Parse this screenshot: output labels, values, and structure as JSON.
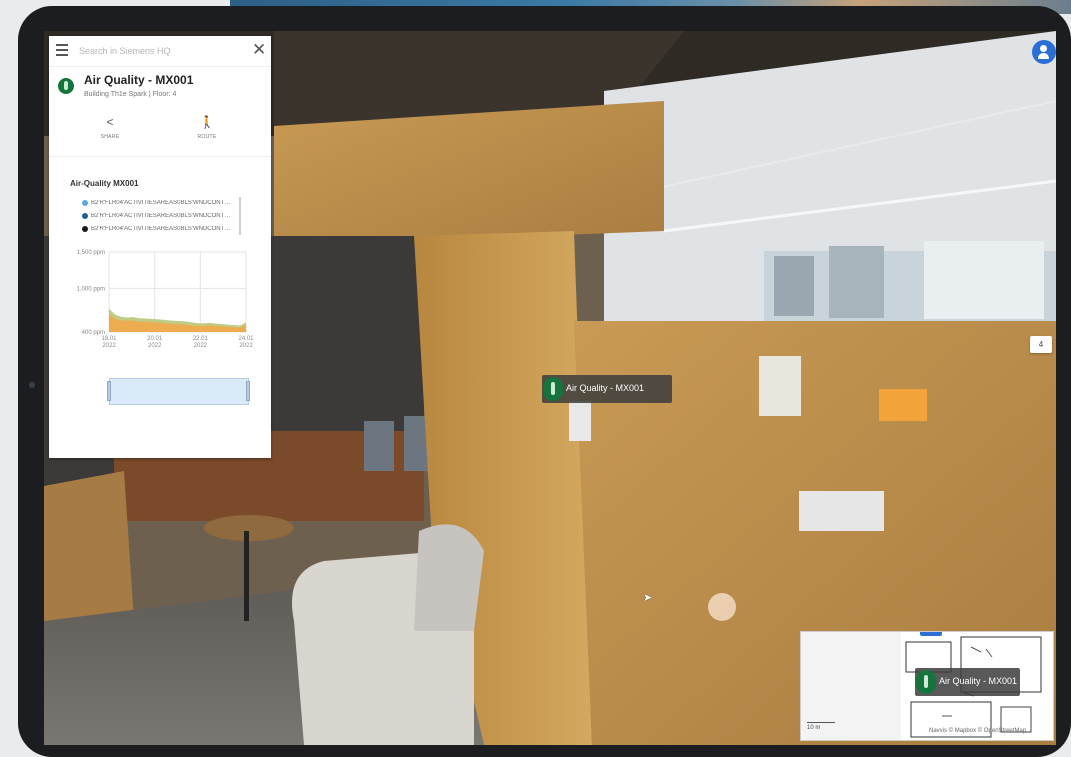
{
  "search": {
    "placeholder": "Search in Siemens HQ"
  },
  "poi": {
    "title": "Air Quality - MX001",
    "subtitle": "Building Th1e Spark | Floor: 4"
  },
  "actions": {
    "share": "SHARE",
    "route": "ROUTE"
  },
  "chart": {
    "title": "Air-Quality MX001",
    "legend": [
      {
        "label": "B2'R'FLR04'ACTIVITIESAREAS0BLS'WNDCONT1'...",
        "color": "#5aa9e6"
      },
      {
        "label": "B2'R'FLR04'ACTIVITIESAREAS0BLS'WNDCONT1'...",
        "color": "#1f5c99"
      },
      {
        "label": "B2'R'FLR04'ACTIVITIESAREAS0BLS'WNDCONT1'...",
        "color": "#1a1a1a"
      }
    ]
  },
  "chart_data": {
    "type": "area",
    "yticks": [
      "1,500 ppm",
      "1,000 ppm",
      "400 ppm"
    ],
    "ylim": [
      400,
      1500
    ],
    "xticks": [
      [
        "18.01",
        "2022"
      ],
      [
        "20.01",
        "2022"
      ],
      [
        "22.01",
        "2022"
      ],
      [
        "24.01",
        "2022"
      ]
    ],
    "series": [
      {
        "values": [
          720,
          640,
          610,
          600,
          605,
          590,
          585,
          580,
          575,
          570,
          560,
          555,
          550,
          545,
          530,
          520,
          520,
          525,
          515,
          510,
          500,
          495,
          490,
          530
        ],
        "color": "#b8c775"
      },
      {
        "values": [
          650,
          580,
          560,
          555,
          560,
          545,
          540,
          535,
          530,
          525,
          515,
          510,
          505,
          500,
          490,
          485,
          485,
          490,
          480,
          475,
          470,
          465,
          460,
          500
        ],
        "color": "#f2a94a"
      }
    ]
  },
  "view": {
    "tag_label": "Air Quality - MX001",
    "floor_badge": "4",
    "minimap_label": "Air Quality - MX001",
    "minimap_scale": "10 m",
    "minimap_attribution": "Navvis © Mapbox © OpenStreetMap"
  },
  "colors": {
    "accent_green": "#14743c",
    "accent_blue": "#2b6fd6"
  },
  "icons": {
    "menu": "menu-icon",
    "close": "close-icon",
    "share": "share-icon",
    "route": "walking-person-icon",
    "profile": "user-icon"
  }
}
